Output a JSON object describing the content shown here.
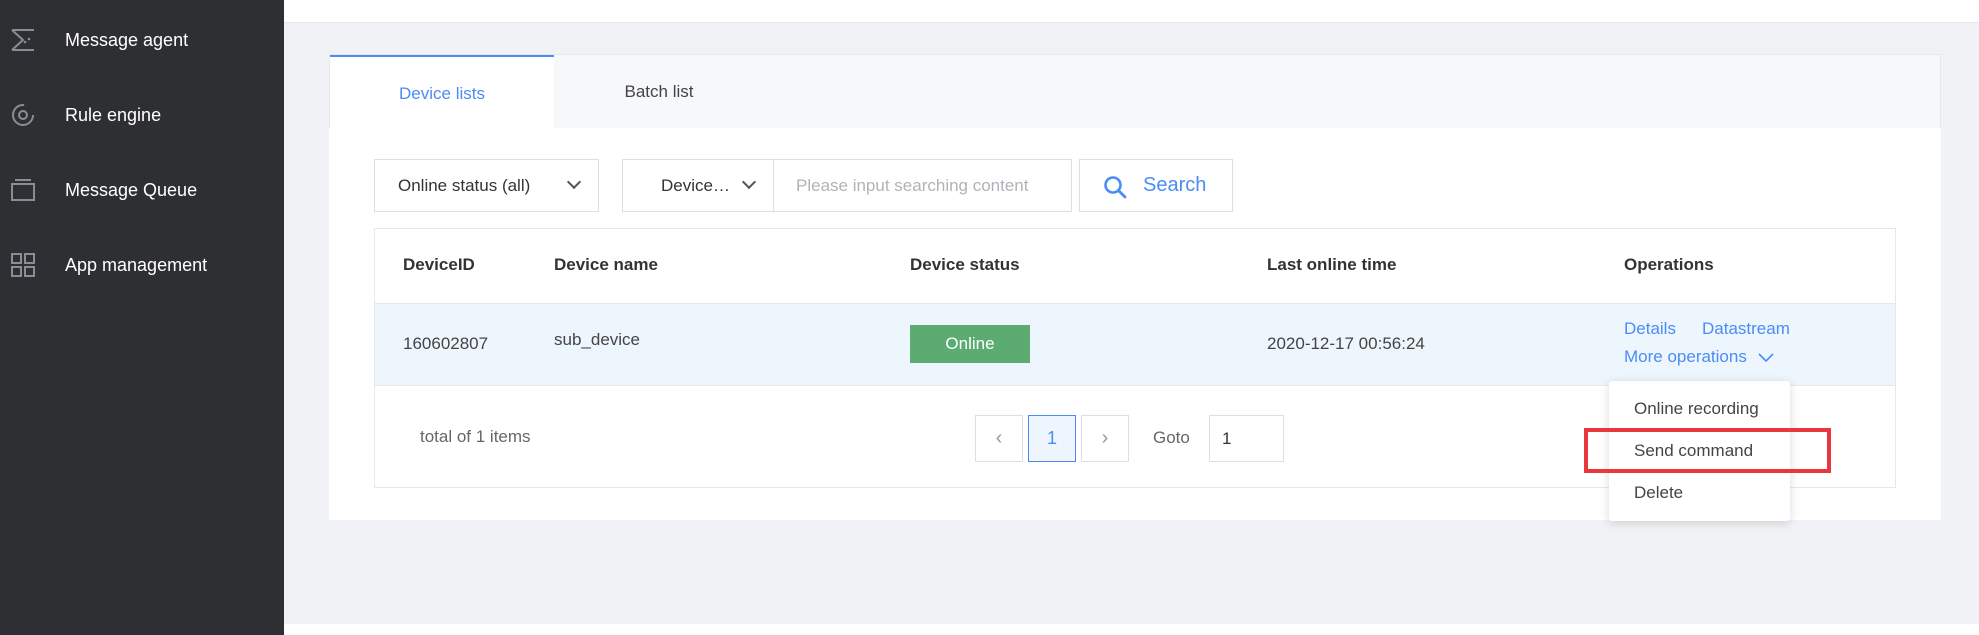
{
  "sidebar": {
    "items": [
      {
        "label": "Message agent",
        "icon": "message-agent-icon"
      },
      {
        "label": "Rule engine",
        "icon": "rule-engine-icon"
      },
      {
        "label": "Message Queue",
        "icon": "message-queue-icon"
      },
      {
        "label": "App management",
        "icon": "grid-icon"
      }
    ]
  },
  "tabs": [
    {
      "label": "Device lists",
      "active": true
    },
    {
      "label": "Batch list",
      "active": false
    }
  ],
  "filters": {
    "status_select": "Online status (all)",
    "field_select": "Device…",
    "search_placeholder": "Please input searching content",
    "search_button": "Search"
  },
  "table": {
    "columns": [
      "DeviceID",
      "Device name",
      "Device status",
      "Last online time",
      "Operations"
    ],
    "rows": [
      {
        "device_id": "160602807",
        "device_name": "sub_device",
        "status": "Online",
        "last_online": "2020-12-17 00:56:24",
        "ops": {
          "details": "Details",
          "datastream": "Datastream",
          "more": "More operations"
        }
      }
    ]
  },
  "pagination": {
    "total": "total of 1 items",
    "current_page": "1",
    "goto_label": "Goto",
    "goto_value": "1"
  },
  "dropdown": {
    "items": [
      "Online recording",
      "Send command",
      "Delete"
    ]
  },
  "colors": {
    "sidebar_bg": "#2d2f33",
    "accent": "#4a8cf6",
    "online_badge": "#5bab72",
    "highlight": "#e8383d"
  }
}
